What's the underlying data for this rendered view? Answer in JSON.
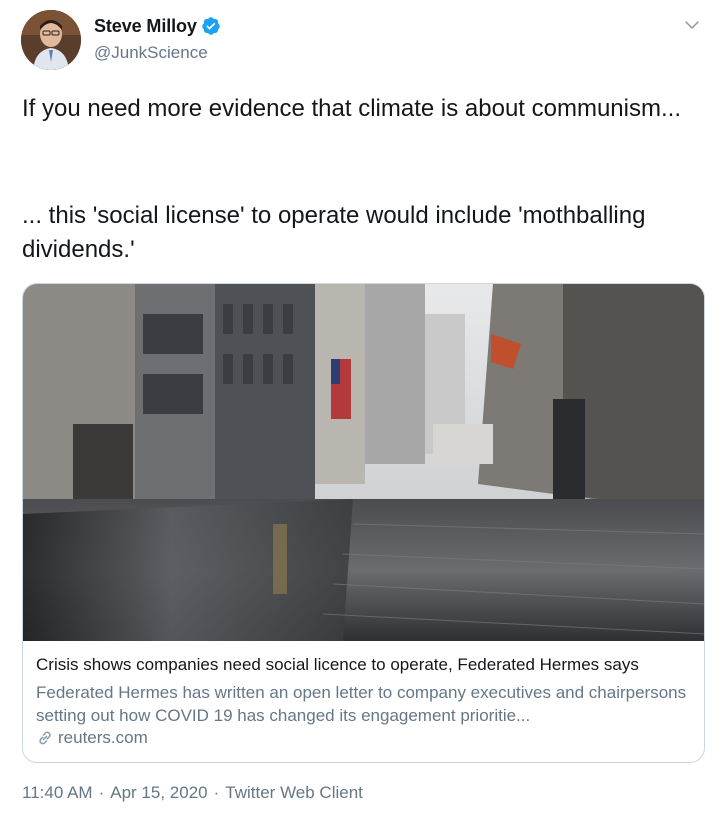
{
  "author": {
    "display_name": "Steve Milloy",
    "handle": "@JunkScience",
    "verified": true
  },
  "tweet": {
    "text_line1": "If you need more evidence that climate is about communism...",
    "text_line2": "... this 'social license' to operate would include 'mothballing dividends.'"
  },
  "card": {
    "title": "Crisis shows companies need social licence to operate, Federated Hermes says",
    "description": "Federated Hermes has written an open letter to company executives and chairpersons setting out how COVID 19 has changed its engagement prioritie...",
    "domain": "reuters.com"
  },
  "meta": {
    "time": "11:40 AM",
    "date": "Apr 15, 2020",
    "source": "Twitter Web Client",
    "separator": "·"
  },
  "colors": {
    "text": "#14171a",
    "secondary": "#657786",
    "verified": "#1da1f2",
    "border": "#ccd6dd"
  },
  "icons": [
    "verified-badge-icon",
    "chevron-down-icon",
    "link-icon"
  ]
}
